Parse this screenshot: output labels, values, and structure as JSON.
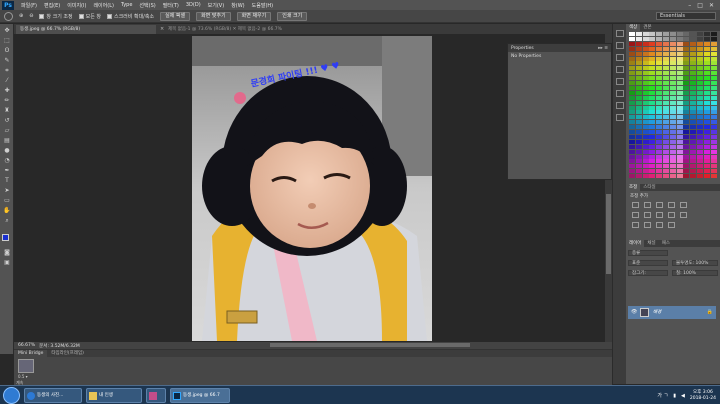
{
  "menubar": {
    "logo": "Ps",
    "items": [
      "파일(F)",
      "편집(E)",
      "이미지(I)",
      "레이어(L)",
      "Type",
      "선택(S)",
      "필터(T)",
      "3D(D)",
      "보기(V)",
      "창(W)",
      "도움말(H)"
    ],
    "win": [
      "–",
      "□",
      "✕"
    ]
  },
  "options": {
    "zoom_in": "⊕",
    "zoom_out": "⊖",
    "resize_label": "창 크기 조정",
    "all_windows": "모든 창",
    "scrubby": "스크러비 확대/축소",
    "actual": "실제 픽셀",
    "fit": "화면 맞추기",
    "fill": "화면 채우기",
    "print": "인쇄 크기",
    "workspace": "Essentials"
  },
  "document": {
    "tab_title": "동생.jpeg @ 66.7% (RGB/8)",
    "tab_close": "×",
    "tab2": "제목 없음-1 @ 73.6% (RGB/8) ✕  제목 없음-2 @ 66.7%"
  },
  "overlay_text": "문경희 파이팅 !!! ♥ ♥",
  "status": {
    "zoom": "66.67%",
    "doc": "문서: 3.52M/6.32M"
  },
  "bridge": {
    "tabs": [
      "Mini Bridge",
      "타임라인(프레임)"
    ],
    "thumb_label": "0.5 ▾",
    "foot": "계속"
  },
  "properties": {
    "title": "Properties",
    "body": "No Properties",
    "controls": "▸▸ ≡"
  },
  "right_panel": {
    "swatch_tabs": [
      "색상",
      "견본"
    ],
    "adjust_tabs": [
      "조정",
      "스타일"
    ],
    "adjust_label": "조정 추가",
    "layer_tabs": [
      "레이어",
      "채널",
      "패스"
    ],
    "kind": "종류",
    "mode": "표준",
    "opacity": "불투명도: 100%",
    "lock": "잠그기:",
    "fill": "칠: 100%",
    "layer_name": "배경",
    "eye": "👁",
    "lock_icon": "🔒"
  },
  "taskbar": {
    "tasks": [
      "동생의 사진...",
      "내 인생",
      "",
      "동생.jpeg @ 66.7"
    ],
    "lang": "가 ㄱ",
    "time": "오후 3:06",
    "date": "2018-01-24"
  },
  "colors": {
    "ui_dark": "#282828",
    "ui_panel": "#535353",
    "accent": "#31a8ff",
    "layer_selected": "#5b7fa8",
    "foreground": "#1a2fd0",
    "background": "#ffffff"
  }
}
